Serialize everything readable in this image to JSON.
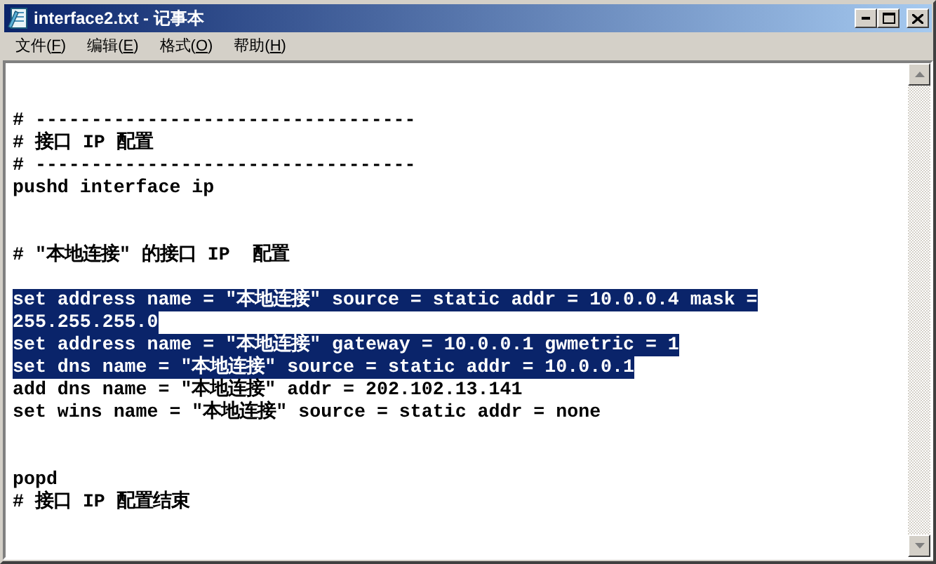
{
  "window": {
    "title": "interface2.txt - 记事本"
  },
  "menu": [
    {
      "before": "文件(",
      "accel": "F",
      "after": ")"
    },
    {
      "before": "编辑(",
      "accel": "E",
      "after": ")"
    },
    {
      "before": "格式(",
      "accel": "O",
      "after": ")"
    },
    {
      "before": "帮助(",
      "accel": "H",
      "after": ")"
    }
  ],
  "lines": [
    {
      "kind": "doublespaced",
      "text": "# ----------------------------------",
      "selected": false
    },
    {
      "kind": "plain",
      "text": "# 接口 IP 配置",
      "selected": false
    },
    {
      "kind": "plain",
      "text": "# ----------------------------------",
      "selected": false
    },
    {
      "kind": "plain",
      "text": "pushd interface ip",
      "selected": false
    },
    {
      "kind": "doublespaced",
      "text": "# \"本地连接\" 的接口 IP  配置",
      "selected": false
    },
    {
      "kind": "spaced",
      "text": "set address name = \"本地连接\" source = static addr = 10.0.0.4 mask =",
      "selected": true
    },
    {
      "kind": "plain",
      "text": "255.255.255.0",
      "selected": true
    },
    {
      "kind": "plain",
      "text": "set address name = \"本地连接\" gateway = 10.0.0.1 gwmetric = 1",
      "selected": true
    },
    {
      "kind": "plain",
      "text": "set dns name = \"本地连接\" source = static addr = 10.0.0.1",
      "selected": true
    },
    {
      "kind": "plain",
      "text": "add dns name = \"本地连接\" addr = 202.102.13.141",
      "selected": false
    },
    {
      "kind": "plain",
      "text": "set wins name = \"本地连接\" source = static addr = none",
      "selected": false
    },
    {
      "kind": "doublespaced",
      "text": "popd",
      "selected": false
    },
    {
      "kind": "plain",
      "text": "# 接口 IP 配置结束",
      "selected": false
    }
  ]
}
